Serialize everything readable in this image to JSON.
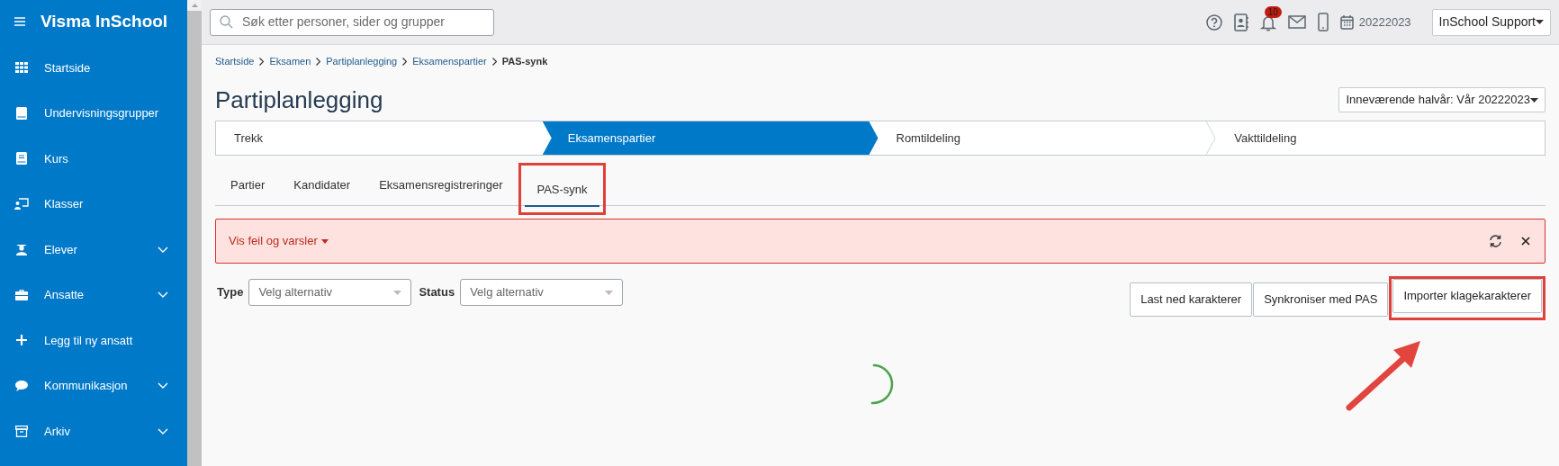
{
  "sidebar": {
    "title": "Visma InSchool",
    "items": [
      {
        "label": "Startside",
        "expandable": false
      },
      {
        "label": "Undervisningsgrupper",
        "expandable": false
      },
      {
        "label": "Kurs",
        "expandable": false
      },
      {
        "label": "Klasser",
        "expandable": false
      },
      {
        "label": "Elever",
        "expandable": true
      },
      {
        "label": "Ansatte",
        "expandable": true
      },
      {
        "label": "Legg til ny ansatt",
        "expandable": false
      },
      {
        "label": "Kommunikasjon",
        "expandable": true
      },
      {
        "label": "Arkiv",
        "expandable": true
      }
    ]
  },
  "top_bar": {
    "search": {
      "placeholder": "Søk etter personer, sider og grupper"
    },
    "notification_count": "10",
    "school_year": "20222023",
    "user_menu": "InSchool Support"
  },
  "breadcrumb": [
    {
      "label": "Startside",
      "current": false
    },
    {
      "label": "Eksamen",
      "current": false
    },
    {
      "label": "Partiplanlegging",
      "current": false
    },
    {
      "label": "Eksamenspartier",
      "current": false
    },
    {
      "label": "PAS-synk",
      "current": true
    }
  ],
  "page_title": "Partiplanlegging",
  "term_dropdown": "Inneværende halvår: Vår 20222023",
  "steps": [
    {
      "label": "Trekk",
      "selected": false
    },
    {
      "label": "Eksamenspartier",
      "selected": true
    },
    {
      "label": "Romtildeling",
      "selected": false
    },
    {
      "label": "Vakttildeling",
      "selected": false
    }
  ],
  "tabs": [
    {
      "label": "Partier",
      "selected": false,
      "highlighted": false
    },
    {
      "label": "Kandidater",
      "selected": false,
      "highlighted": false
    },
    {
      "label": "Eksamensregistreringer",
      "selected": false,
      "highlighted": false
    },
    {
      "label": "PAS-synk",
      "selected": true,
      "highlighted": true
    }
  ],
  "alert": {
    "label": "Vis feil og varsler"
  },
  "filters": [
    {
      "label": "Type",
      "placeholder": "Velg alternativ"
    },
    {
      "label": "Status",
      "placeholder": "Velg alternativ"
    }
  ],
  "buttons": [
    {
      "label": "Last ned karakterer",
      "highlighted": false
    },
    {
      "label": "Synkroniser med PAS",
      "highlighted": false
    },
    {
      "label": "Importer klagekarakterer",
      "highlighted": true
    }
  ],
  "loading": true
}
